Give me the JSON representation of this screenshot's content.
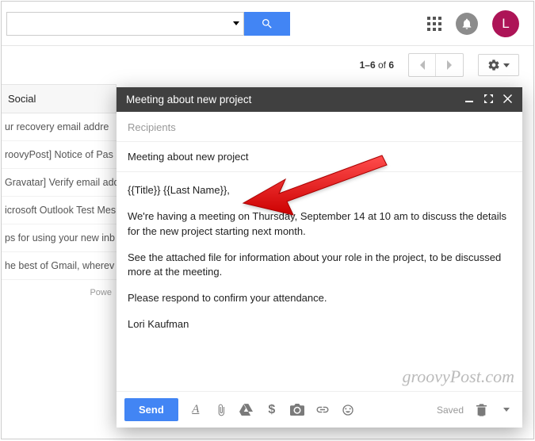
{
  "header": {
    "avatar_initial": "L"
  },
  "pagination": {
    "range": "1–6",
    "of_label": " of ",
    "total": "6"
  },
  "tab": {
    "social": "Social"
  },
  "mail_rows": [
    "ur recovery email addre",
    "roovyPost] Notice of Pas",
    "Gravatar] Verify email add",
    "icrosoft Outlook Test Mes",
    "ps for using your new inb",
    "he best of Gmail, wherev"
  ],
  "powered": "Powe",
  "compose": {
    "title": "Meeting about new project",
    "recipients_placeholder": "Recipients",
    "subject": "Meeting about new project",
    "body": {
      "greeting": "{{Title}} {{Last Name}},",
      "p1": "We're having a meeting on Thursday, September 14 at 10 am to discuss the details for the new project starting next month.",
      "p2": "See the attached file for information about your role in the project, to be discussed more at the meeting.",
      "p3": "Please respond to confirm your attendance.",
      "signature": "Lori Kaufman"
    },
    "send_label": "Send",
    "saved_label": "Saved"
  },
  "watermark": "groovyPost.com"
}
